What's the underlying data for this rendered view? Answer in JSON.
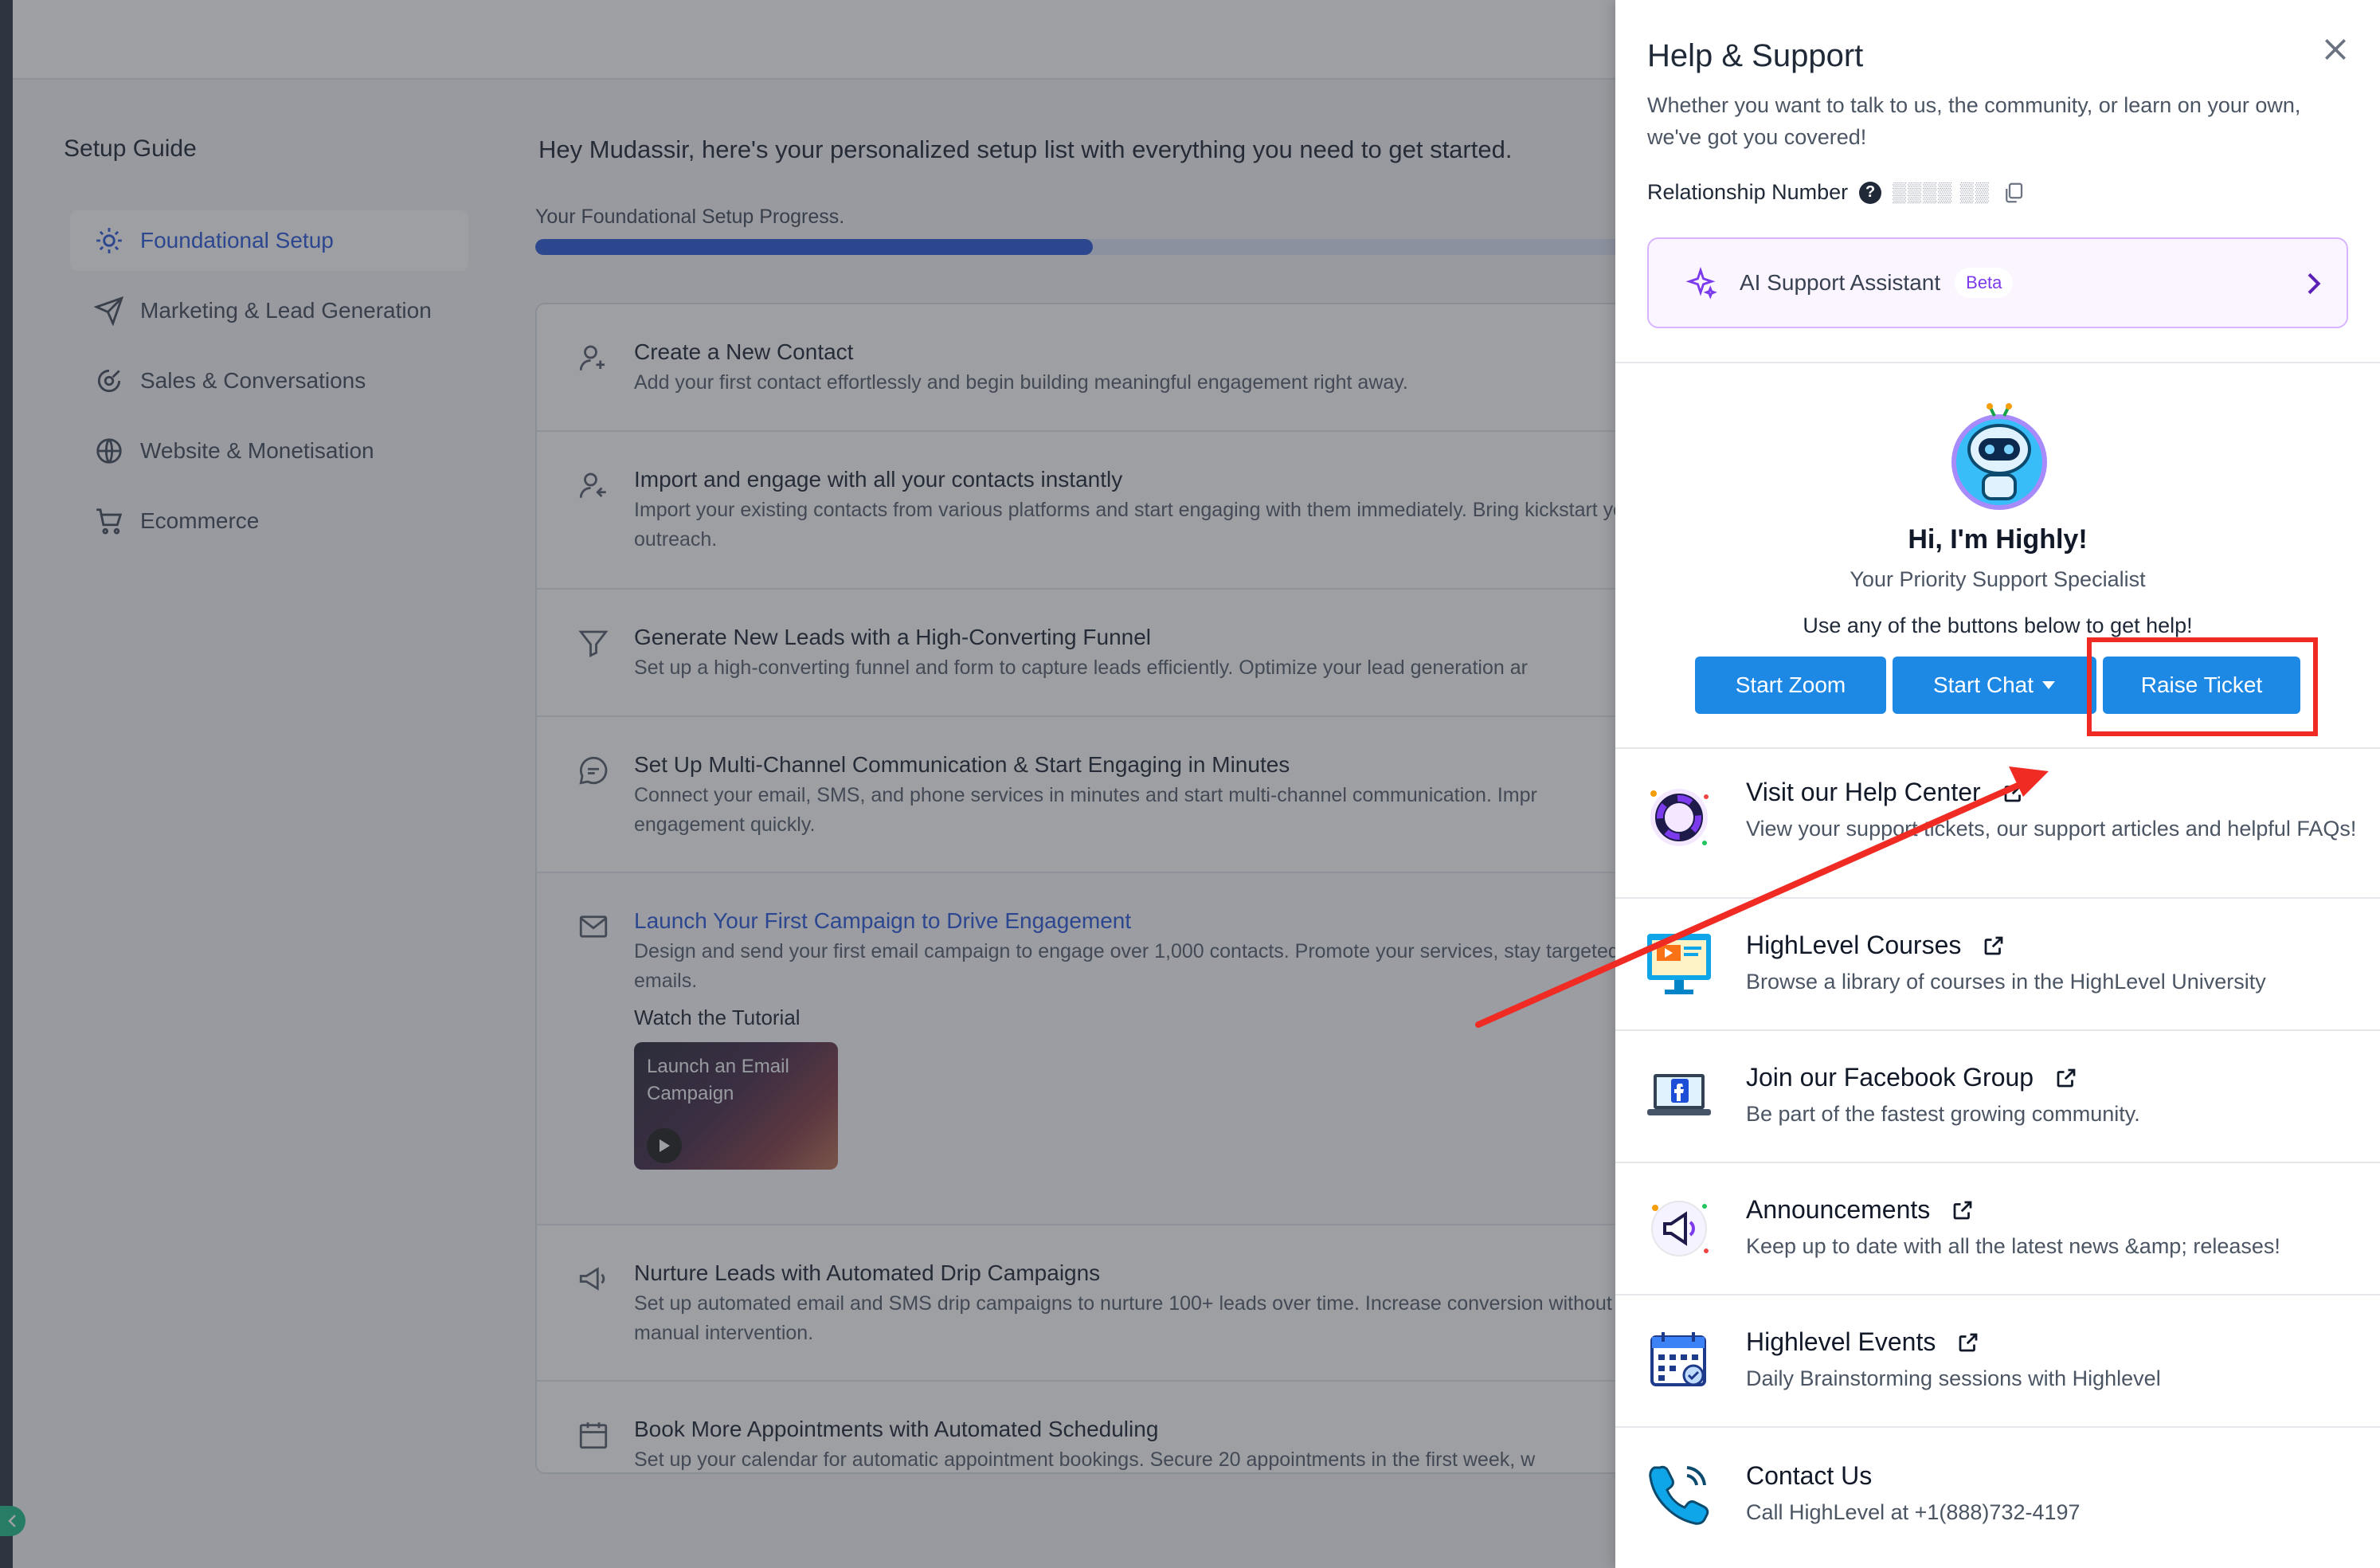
{
  "setup": {
    "sidebar_title": "Setup Guide",
    "nav": [
      {
        "label": "Foundational Setup",
        "icon": "sun-gear-icon",
        "active": true
      },
      {
        "label": "Marketing & Lead Generation",
        "icon": "send-icon"
      },
      {
        "label": "Sales & Conversations",
        "icon": "target-icon"
      },
      {
        "label": "Website & Monetisation",
        "icon": "globe-icon"
      },
      {
        "label": "Ecommerce",
        "icon": "cart-icon"
      }
    ],
    "welcome": "Hey Mudassir, here's your personalized setup list with everything you need to get started.",
    "progress_label": "Your Foundational Setup Progress.",
    "tasks": [
      {
        "title": "Create a New Contact",
        "desc": "Add your first contact effortlessly and begin building meaningful engagement right away.",
        "icon": "add-user-icon"
      },
      {
        "title": "Import and engage with all your contacts instantly",
        "desc": "Import your existing contacts from various platforms and start engaging with them immediately. Bring kickstart your outreach.",
        "icon": "import-user-icon"
      },
      {
        "title": "Generate New Leads with a High-Converting Funnel",
        "desc": "Set up a high-converting funnel and form to capture leads efficiently. Optimize your lead generation ar",
        "icon": "funnel-icon"
      },
      {
        "title": "Set Up Multi-Channel Communication & Start Engaging in Minutes",
        "desc": "Connect your email, SMS, and phone services in minutes and start multi-channel communication. Impr engagement quickly.",
        "icon": "chat-bubble-icon"
      },
      {
        "title": "Launch Your First Campaign to Drive Engagement",
        "desc": "Design and send your first email campaign to engage over 1,000 contacts. Promote your services, stay targeted emails.",
        "icon": "mail-icon",
        "expanded": true
      },
      {
        "title": "Nurture Leads with Automated Drip Campaigns",
        "desc": "Set up automated email and SMS drip campaigns to nurture 100+ leads over time. Increase conversion without manual intervention.",
        "icon": "megaphone-icon"
      },
      {
        "title": "Book More Appointments with Automated Scheduling",
        "desc": "Set up your calendar for automatic appointment bookings. Secure 20 appointments in the first week, w",
        "icon": "calendar-icon"
      }
    ],
    "tutorial_label": "Watch the Tutorial",
    "tutorial_thumb_title": "Launch an Email Campaign"
  },
  "help": {
    "title": "Help & Support",
    "subtitle": "Whether you want to talk to us, the community, or learn on your own, we've got you covered!",
    "relationship_label": "Relationship Number",
    "relationship_value": "▒▒▒▒ ▒▒",
    "ai_label": "AI Support Assistant",
    "ai_badge": "Beta",
    "bot_greeting": "Hi, I'm Highly!",
    "bot_role": "Your Priority Support Specialist",
    "bot_hint": "Use any of the buttons below to get help!",
    "buttons": {
      "zoom": "Start Zoom",
      "chat": "Start Chat",
      "ticket": "Raise Ticket"
    },
    "resources": [
      {
        "title": "Visit our Help Center",
        "desc": "View your support tickets, our support articles and helpful FAQs!",
        "icon": "lifebuoy-icon"
      },
      {
        "title": "HighLevel Courses",
        "desc": "Browse a library of courses in the HighLevel University",
        "icon": "monitor-video-icon"
      },
      {
        "title": "Join our Facebook Group",
        "desc": "Be part of the fastest growing community.",
        "icon": "laptop-facebook-icon"
      },
      {
        "title": "Announcements",
        "desc": "Keep up to date with all the latest news &amp; releases!",
        "icon": "megaphone-icon"
      },
      {
        "title": "Highlevel Events",
        "desc": "Daily Brainstorming sessions with Highlevel",
        "icon": "calendar-icon"
      },
      {
        "title": "Contact Us",
        "desc": "Call HighLevel at +1(888)732-4197",
        "icon": "phone-icon"
      }
    ]
  },
  "colors": {
    "primary_button": "#1e88e5",
    "annotation": "#ef2b24",
    "link": "#1d4ed8",
    "ai_border": "#d8b4fe"
  },
  "progress_fraction": 0.5
}
